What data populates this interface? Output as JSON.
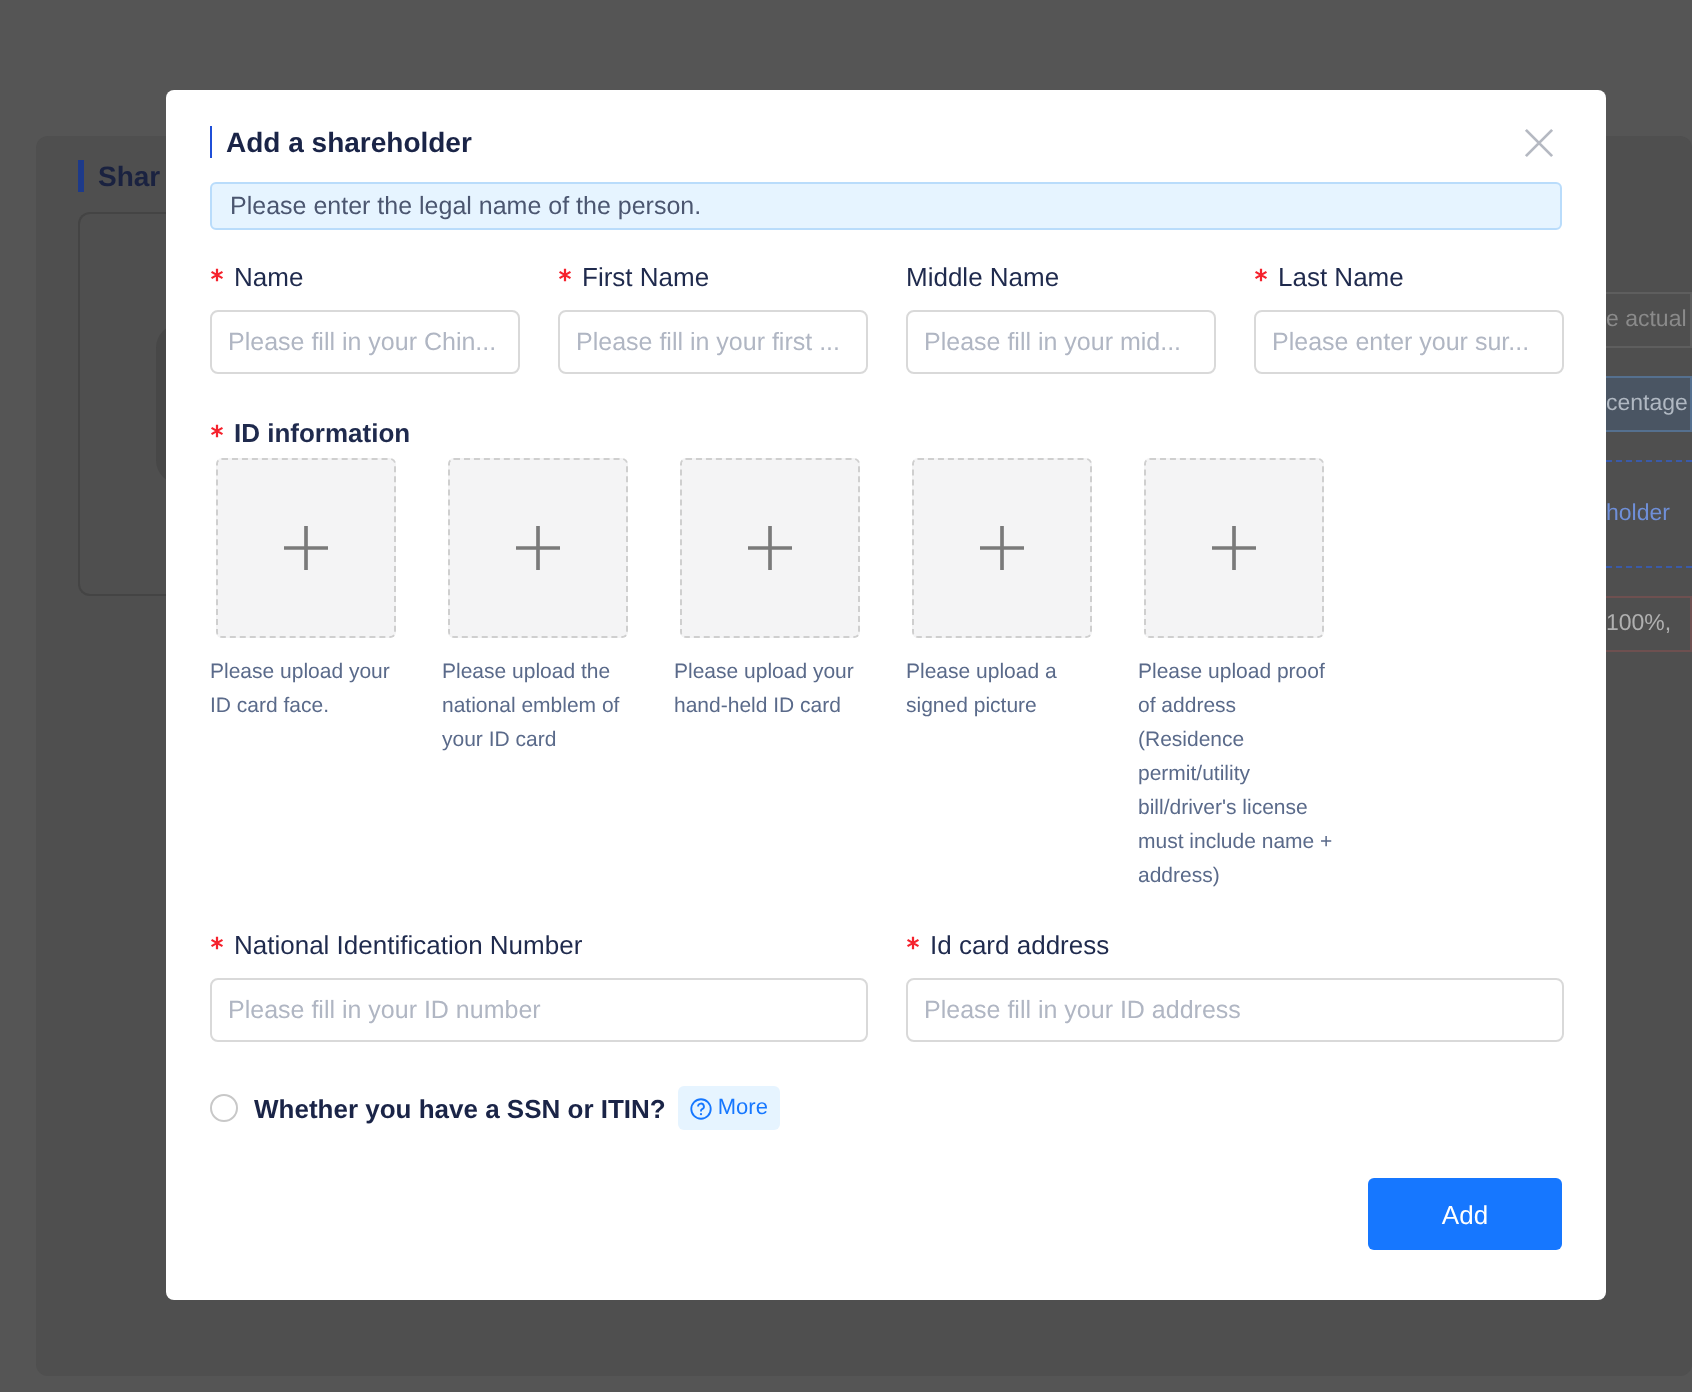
{
  "background": {
    "title": "Shar",
    "texts": [
      {
        "kind": "field",
        "text": "e actual"
      },
      {
        "kind": "button",
        "text": "centage"
      },
      {
        "kind": "link",
        "text": "holder"
      },
      {
        "kind": "note",
        "text": "100%,"
      }
    ]
  },
  "dialog": {
    "title": "Add a shareholder",
    "notice": "Please enter the legal name of the person.",
    "name_fields": [
      {
        "label": "Name",
        "required": true,
        "placeholder": "Please fill in your Chin..."
      },
      {
        "label": "First Name",
        "required": true,
        "placeholder": "Please fill in your first ..."
      },
      {
        "label": "Middle Name",
        "required": false,
        "placeholder": "Please fill in your mid..."
      },
      {
        "label": "Last Name",
        "required": true,
        "placeholder": "Please enter your sur..."
      }
    ],
    "id_information": {
      "label": "ID information",
      "required": true,
      "uploads": [
        {
          "caption": "Please upload your ID card face."
        },
        {
          "caption": "Please upload the national emblem of your ID card"
        },
        {
          "caption": "Please upload your hand-held ID card"
        },
        {
          "caption": "Please upload a signed picture"
        },
        {
          "caption": "Please upload proof of address (Residence permit/utility bill/driver's license must include name + address)"
        }
      ]
    },
    "id_fields": [
      {
        "label": "National Identification Number",
        "required": true,
        "placeholder": "Please fill in your ID number"
      },
      {
        "label": "Id card address",
        "required": true,
        "placeholder": "Please fill in your ID address"
      }
    ],
    "ssn": {
      "label": "Whether you have a SSN or ITIN?",
      "checked": false,
      "more": "More"
    },
    "submit": "Add"
  }
}
